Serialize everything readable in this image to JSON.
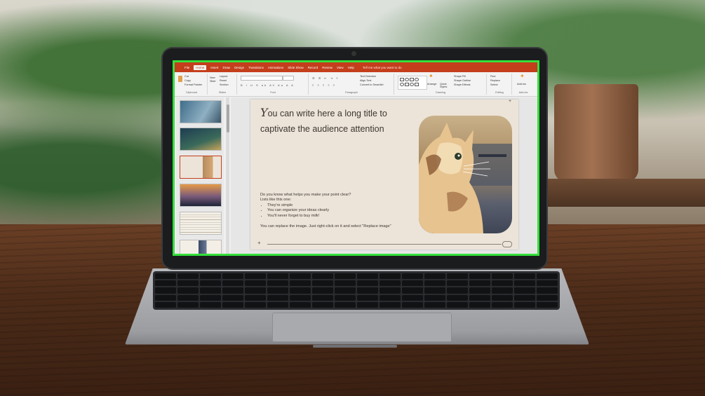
{
  "ribbon_tabs": [
    "File",
    "Home",
    "Insert",
    "Draw",
    "Design",
    "Transitions",
    "Animations",
    "Slide Show",
    "Record",
    "Review",
    "View",
    "Help"
  ],
  "active_tab": "Home",
  "tell_me": "Tell me what you want to do",
  "clipboard": {
    "cut": "Cut",
    "copy": "Copy",
    "format_painter": "Format Painter",
    "group_label": "Clipboard"
  },
  "slides_group": {
    "new_slide": "New Slide",
    "layout": "Layout",
    "reset": "Reset",
    "section": "Section",
    "group_label": "Slides"
  },
  "font_group": {
    "group_label": "Font"
  },
  "paragraph_group": {
    "text_direction": "Text Direction",
    "align_text": "Align Text",
    "convert_smartart": "Convert to SmartArt",
    "group_label": "Paragraph"
  },
  "drawing_group": {
    "arrange": "Arrange",
    "quick_styles": "Quick Styles",
    "shape_fill": "Shape Fill",
    "shape_outline": "Shape Outline",
    "shape_effects": "Shape Effects",
    "group_label": "Drawing"
  },
  "editing_group": {
    "find": "Find",
    "replace": "Replace",
    "select": "Select",
    "group_label": "Editing"
  },
  "addins_group": {
    "addins": "Add-ins",
    "group_label": "Add-ins"
  },
  "slide": {
    "title_cap": "Y",
    "title_rest": "ou can write here a long title to captivate the audience attention",
    "intro": "Do you know what helps you make your point clear?",
    "lists_intro": "Lists like this one:",
    "bullets": [
      "They're simple",
      "You can organize your ideas clearly",
      "You'll never forget to buy milk!"
    ],
    "footer_text": "You can replace the image. Just right-click on it and select \"Replace image\""
  },
  "colors": {
    "accent": "#c43e1c",
    "selection_border": "#33e03b",
    "slide_bg": "#ece4d9"
  }
}
